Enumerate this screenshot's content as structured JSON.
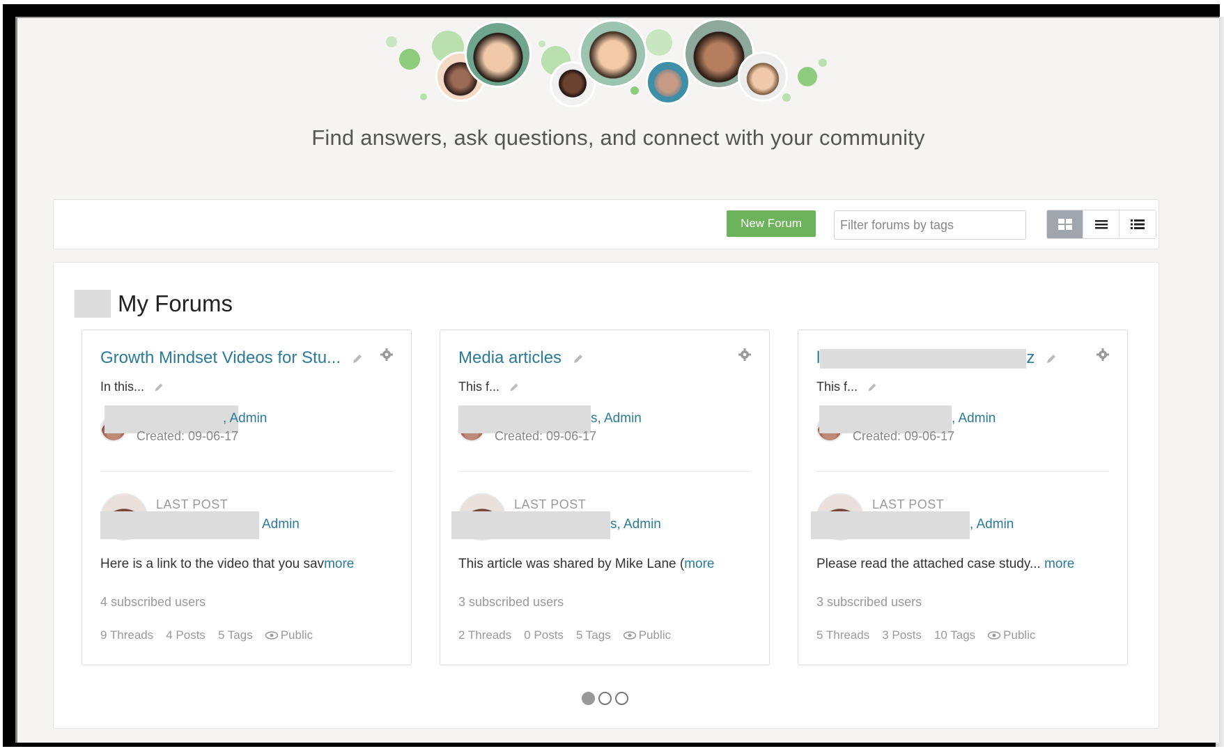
{
  "hero": {
    "tagline": "Find answers, ask questions, and connect with your community"
  },
  "toolbar": {
    "new_forum_label": "New Forum",
    "filter_placeholder": "Filter forums by tags",
    "view_buttons": [
      "grid-view-icon",
      "list-view-icon",
      "detail-list-view-icon"
    ],
    "active_view": "grid"
  },
  "section": {
    "title": "My Forums"
  },
  "forums": [
    {
      "title": "Growth Mindset Videos for Stu...",
      "description": "In this...",
      "owner_role": ", Admin",
      "created": "Created: 09-06-17",
      "last_post_label": "LAST POST",
      "last_post_role": "Admin",
      "snippet": "Here is a link to the video that you sav",
      "more": "more",
      "subscribed": "4 subscribed users",
      "threads": "9 Threads",
      "posts": "4 Posts",
      "tags": "5 Tags",
      "visibility": "Public"
    },
    {
      "title": "Media articles",
      "description": "This f...",
      "owner_role": "s, Admin",
      "created": "Created: 09-06-17",
      "last_post_label": "LAST POST",
      "last_post_role": "s, Admin",
      "snippet": "This article was shared by Mike Lane (",
      "more": "more",
      "subscribed": "3 subscribed users",
      "threads": "2 Threads",
      "posts": "0 Posts",
      "tags": "5 Tags",
      "visibility": "Public"
    },
    {
      "title": "l",
      "title_tail": "z",
      "description": "This f...",
      "owner_role": ", Admin",
      "created": "Created: 09-06-17",
      "last_post_label": "LAST POST",
      "last_post_role": ", Admin",
      "snippet": "Please read the attached case study... ",
      "more": "more",
      "subscribed": "3 subscribed users",
      "threads": "5 Threads",
      "posts": "3 Posts",
      "tags": "10 Tags",
      "visibility": "Public"
    }
  ],
  "pagination": {
    "pages": 3,
    "active": 1
  },
  "colors": {
    "accent_green": "#6cb35b",
    "link_blue": "#2a7a9a",
    "bubble_green": "#8fcb7d"
  }
}
